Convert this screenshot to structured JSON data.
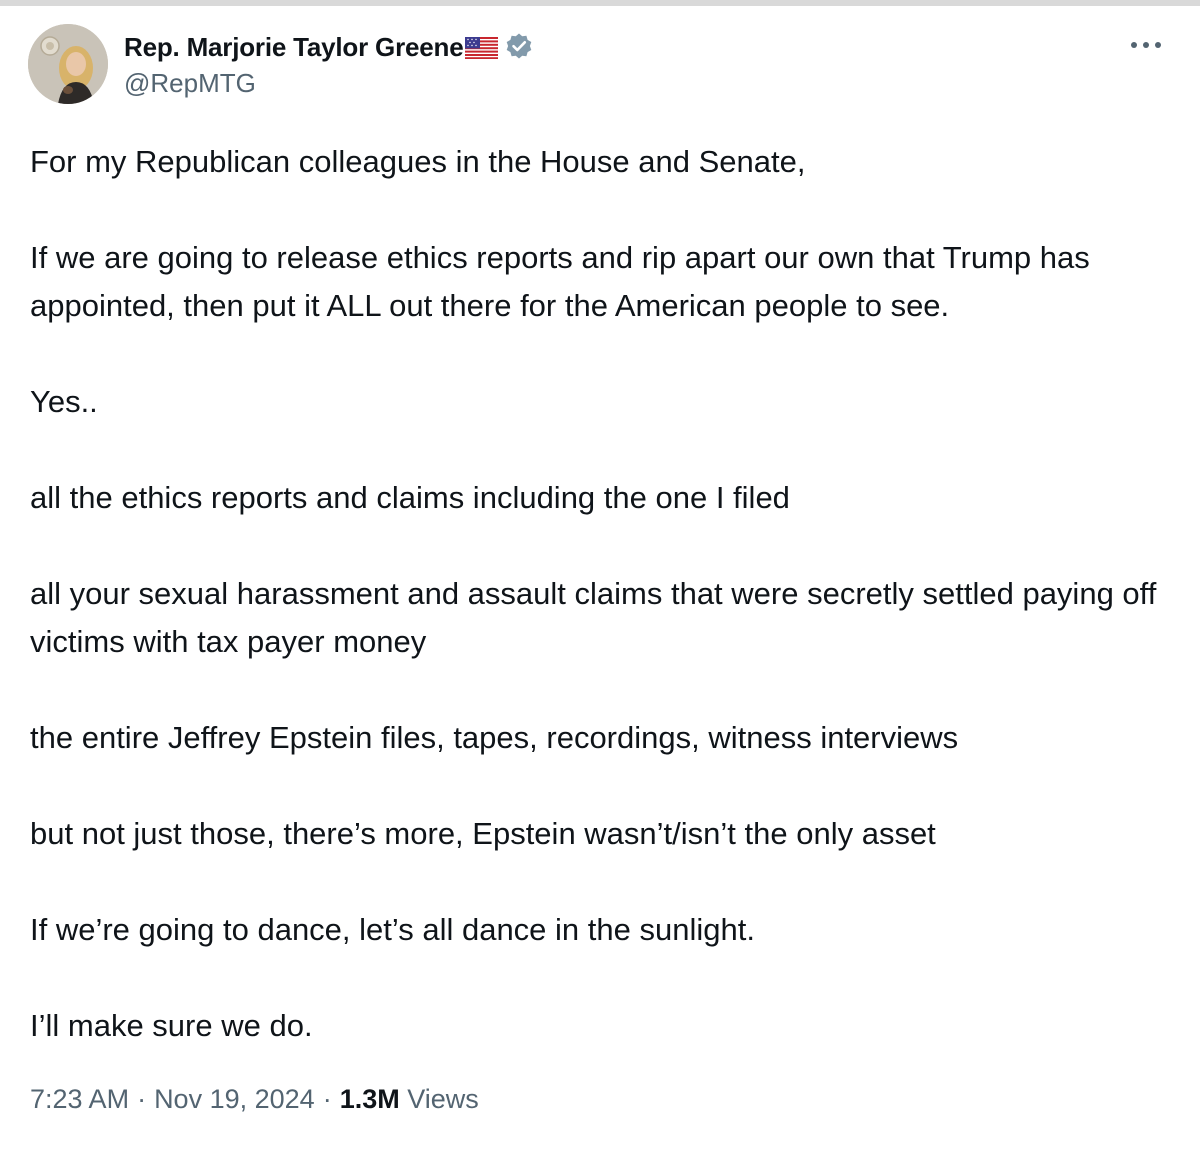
{
  "author": {
    "display_name": "Rep. Marjorie Taylor Greene",
    "handle": "@RepMTG",
    "flag_icon": "us-flag-icon",
    "verified_icon": "verified-badge-icon",
    "verified_color": "#829aab"
  },
  "menu": {
    "more_icon": "more-options-icon"
  },
  "tweet": {
    "paragraphs": [
      "For my Republican colleagues in the House and Senate,",
      "If we are going to release ethics reports and rip apart our own that Trump has appointed, then put it ALL out there for the American people to see.",
      "Yes..",
      "all the ethics reports and claims including the one I filed",
      "all your sexual harassment and assault claims that were secretly settled paying off victims with tax payer money",
      "the entire Jeffrey Epstein files, tapes, recordings, witness interviews",
      "but not just those, there’s more, Epstein wasn’t/isn’t the only asset",
      "If we’re going to dance, let’s all dance in the sunlight.",
      "I’ll make sure we do."
    ]
  },
  "meta": {
    "time": "7:23 AM",
    "separator": "·",
    "date": "Nov 19, 2024",
    "views_count": "1.3M",
    "views_label": "Views"
  },
  "colors": {
    "text": "#0f1419",
    "secondary_text": "#536471"
  }
}
